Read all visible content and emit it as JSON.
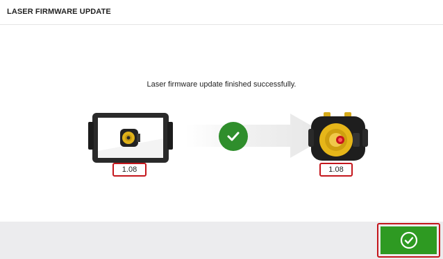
{
  "header": {
    "title": "LASER FIRMWARE UPDATE"
  },
  "main": {
    "status_message": "Laser firmware update finished successfully.",
    "source_device": {
      "icon": "tablet-device-icon",
      "firmware_version": "1.08"
    },
    "progress_icon": "check-circle-icon",
    "target_device": {
      "icon": "laser-sensor-icon",
      "firmware_version": "1.08"
    }
  },
  "footer": {
    "confirm_icon": "check-circle-icon"
  },
  "colors": {
    "success_green": "#2f8e2c",
    "button_green": "#2e9a22",
    "highlight_red": "#c4161c",
    "footer_gray": "#ececee"
  }
}
